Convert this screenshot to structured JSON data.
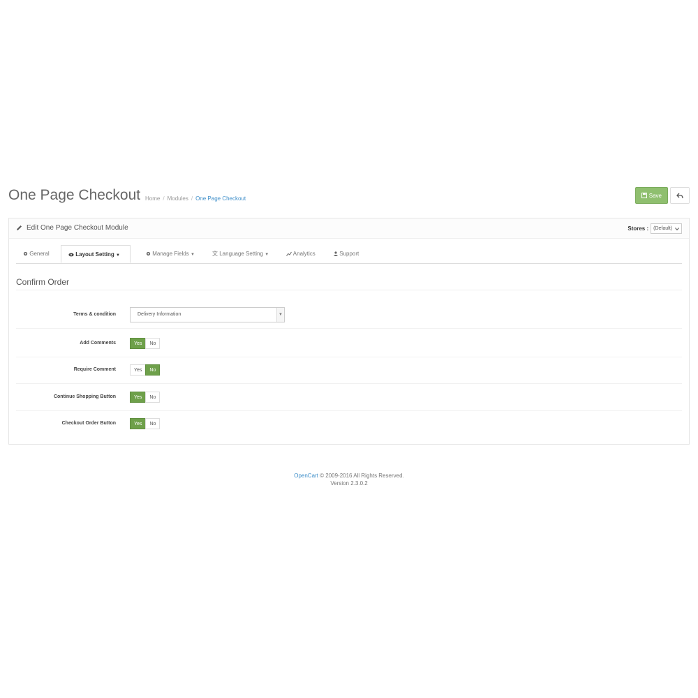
{
  "header": {
    "title": "One Page Checkout",
    "breadcrumb": [
      "Home",
      "Modules",
      "One Page Checkout"
    ],
    "save_label": "Save"
  },
  "panel": {
    "title": "Edit One Page Checkout Module",
    "stores_label": "Stores :",
    "stores_value": "(Default)"
  },
  "tabs": [
    {
      "label": "General",
      "icon": "gear-icon"
    },
    {
      "label": "Layout Setting",
      "icon": "eye-icon",
      "active": true
    },
    {
      "label": "Manage Fields",
      "icon": "gear-icon"
    },
    {
      "label": "Language Setting",
      "icon": "translate-icon"
    },
    {
      "label": "Analytics",
      "icon": "chart-icon"
    },
    {
      "label": "Support",
      "icon": "user-icon"
    }
  ],
  "section": {
    "title": "Confirm Order",
    "rows": [
      {
        "label": "Terms & condition",
        "type": "select",
        "value": "Delivery Information"
      },
      {
        "label": "Add Comments",
        "type": "toggle",
        "yes": "Yes",
        "no": "No",
        "selected": "Yes"
      },
      {
        "label": "Require Comment",
        "type": "toggle",
        "yes": "Yes",
        "no": "No",
        "selected": "No"
      },
      {
        "label": "Continue Shopping Button",
        "type": "toggle",
        "yes": "Yes",
        "no": "No",
        "selected": "Yes"
      },
      {
        "label": "Checkout Order Button",
        "type": "toggle",
        "yes": "Yes",
        "no": "No",
        "selected": "Yes"
      }
    ]
  },
  "footer": {
    "brand": "OpenCart",
    "copyright": " © 2009-2016 All Rights Reserved.",
    "version": "Version 2.3.0.2"
  },
  "colors": {
    "accent_green": "#6ea04a",
    "save_green": "#8fbf6f",
    "link_blue": "#3d8ec9"
  }
}
